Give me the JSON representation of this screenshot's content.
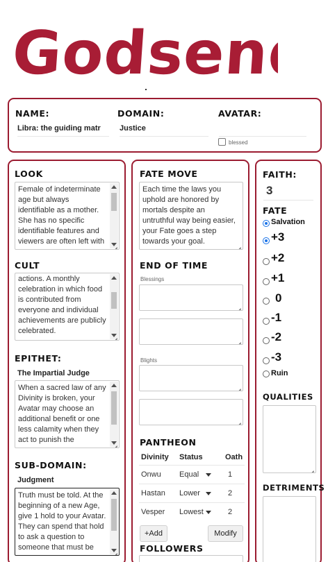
{
  "app_title": "Godsend",
  "identity": {
    "name_label": "NAME:",
    "name_value": "Libra: the guiding matr",
    "domain_label": "DOMAIN:",
    "domain_value": "Justice",
    "avatar_label": "AVATAR:",
    "blessed_label": "blessed"
  },
  "look": {
    "label": "LOOK",
    "text": "Female of indeterminate age but always identifiable as a mother. She has no specific identifiable features and viewers are often left with"
  },
  "cult": {
    "label": "CULT",
    "text": "actions. A monthly celebration in which food is contributed from everyone and individual achievements are publicly celebrated."
  },
  "epithet": {
    "label": "EPITHET:",
    "value": "The Impartial Judge",
    "text": "When a sacred law of any Divinity is broken, your Avatar may choose an additional benefit or one less calamity when they act to punish the"
  },
  "subdomain": {
    "label": "SUB-DOMAIN:",
    "value": "Judgment",
    "text": "Truth must be told. At the beginning of a new Age, give 1 hold to your Avatar. They can spend that hold to ask a question to someone that must be"
  },
  "fate_move": {
    "label": "FATE MOVE",
    "text": "Each time the laws you uphold are honored by mortals despite an untruthful way being easier, your Fate goes a step towards your goal."
  },
  "end_of_time": {
    "label": "END OF TIME",
    "blessings_label": "Blessings",
    "blights_label": "Blights"
  },
  "pantheon": {
    "label": "PANTHEON",
    "columns": [
      "Divinity",
      "Status",
      "Oath"
    ],
    "rows": [
      {
        "divinity": "Onwu",
        "status": "Equal",
        "oath": "1"
      },
      {
        "divinity": "Hastan",
        "status": "Lower",
        "oath": "2"
      },
      {
        "divinity": "Vesper",
        "status": "Lowest",
        "oath": "2"
      }
    ],
    "add_label": "+Add",
    "modify_label": "Modify"
  },
  "followers": {
    "label": "FOLLOWERS"
  },
  "faith": {
    "label": "FAITH:",
    "value": "3"
  },
  "fate": {
    "label": "FATE",
    "options": [
      "Salvation",
      "+3",
      "+2",
      "+1",
      "0",
      "-1",
      "-2",
      "-3",
      "Ruin"
    ],
    "selected": [
      "Salvation",
      "+3"
    ]
  },
  "qualities": {
    "label": "QUALITIES"
  },
  "detriments": {
    "label": "DETRIMENTS"
  },
  "colors": {
    "accent": "#9b1b30"
  }
}
